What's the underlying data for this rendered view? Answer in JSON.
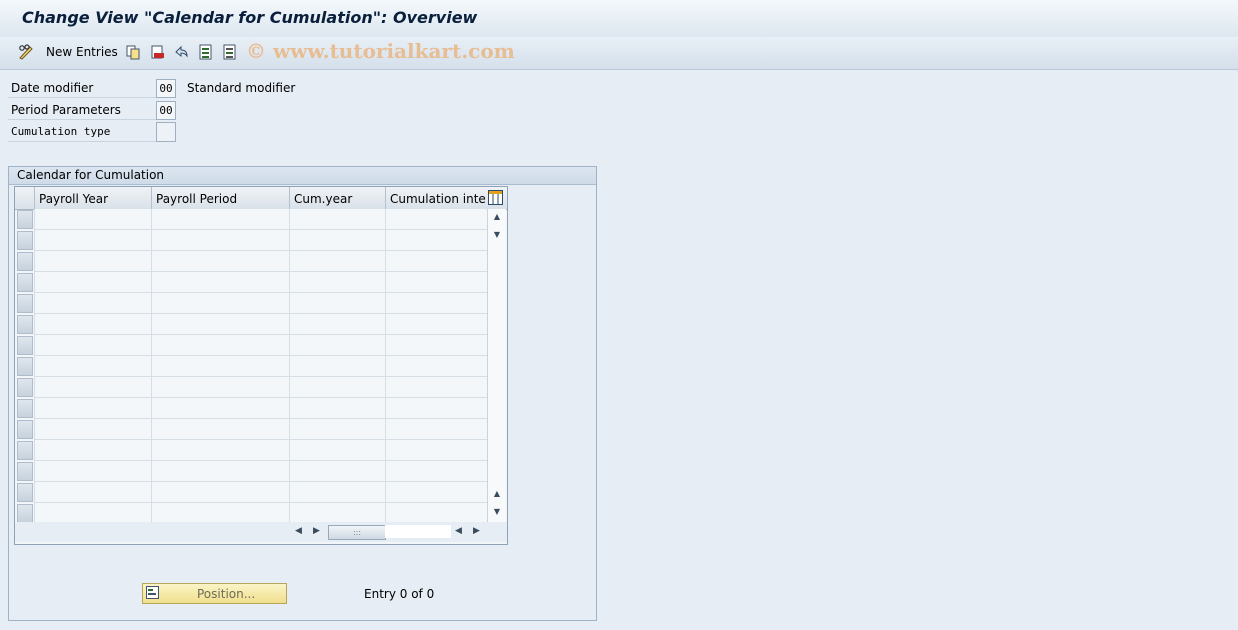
{
  "window": {
    "title": "Change View \"Calendar for Cumulation\": Overview"
  },
  "toolbar": {
    "new_entries_label": "New Entries",
    "icons": [
      "pencil-glasses-icon",
      "copy-icon",
      "delete-icon",
      "undo-icon",
      "select-all-icon",
      "deselect-all-icon"
    ]
  },
  "watermark": "© www.tutorialkart.com",
  "fields": {
    "date_modifier": {
      "label": "Date modifier",
      "value": "00",
      "description": "Standard modifier"
    },
    "period_parameters": {
      "label": "Period Parameters",
      "value": "00"
    },
    "cumulation_type": {
      "label": "Cumulation type",
      "value": ""
    }
  },
  "group": {
    "title": "Calendar for Cumulation"
  },
  "table": {
    "columns": [
      "Payroll Year",
      "Payroll Period",
      "Cum.year",
      "Cumulation inte"
    ],
    "rows": []
  },
  "footer": {
    "position_label": "Position...",
    "entry_text": "Entry 0 of 0"
  },
  "colors": {
    "background": "#e6edf4",
    "title_text": "#0a1f3c",
    "button_yellow": "#f0df8c"
  }
}
